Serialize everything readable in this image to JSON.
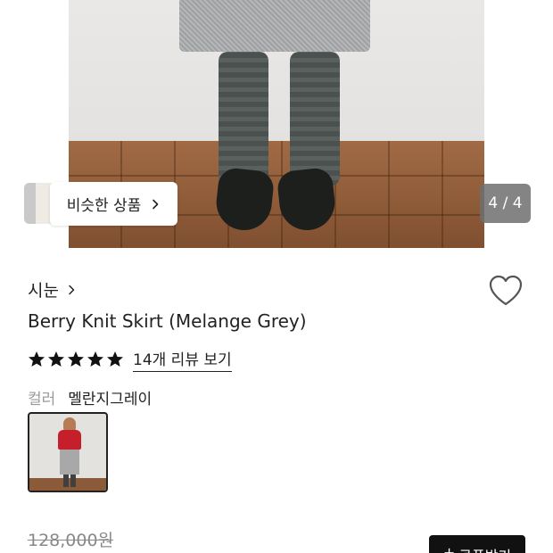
{
  "gallery": {
    "similar_label": "비슷한 상품",
    "counter": "4 / 4"
  },
  "product": {
    "brand": "시눈",
    "title": "Berry Knit Skirt (Melange Grey)",
    "rating": {
      "stars": 5,
      "review_link": "14개 리뷰 보기"
    },
    "color": {
      "label": "컬러",
      "value": "멜란지그레이"
    },
    "original_price": "128,000원"
  },
  "actions": {
    "coupon_label": "쿠폰받기",
    "coupon_prefix": "+"
  },
  "colors": {
    "accent_black": "#111111",
    "star": "#111111",
    "muted": "#999999"
  },
  "icons": [
    "chevron-right-icon",
    "heart-icon",
    "star-icon",
    "plus-icon"
  ]
}
